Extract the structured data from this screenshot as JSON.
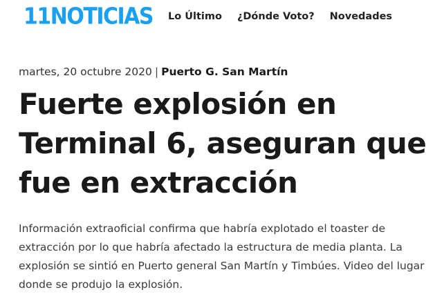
{
  "header": {
    "logo_text": "11NOTICIAS",
    "brand_color": "#1aa0ef",
    "nav": [
      {
        "label": "Lo Último"
      },
      {
        "label": "¿Dónde Voto?"
      },
      {
        "label": "Novedades"
      }
    ]
  },
  "article": {
    "date": "martes, 20 octubre 2020",
    "separator": "|",
    "location": "Puerto G. San Martín",
    "title": "Fuerte explosión en Terminal 6, aseguran que fue en extracción",
    "summary": "Información extraoficial confirma que habría explotado el toaster de extracción por lo que habría afectado la estructura de media planta. La explosión se sintió en Puerto general San Martín y Timbúes. Video del lugar donde se produjo la explosión."
  }
}
